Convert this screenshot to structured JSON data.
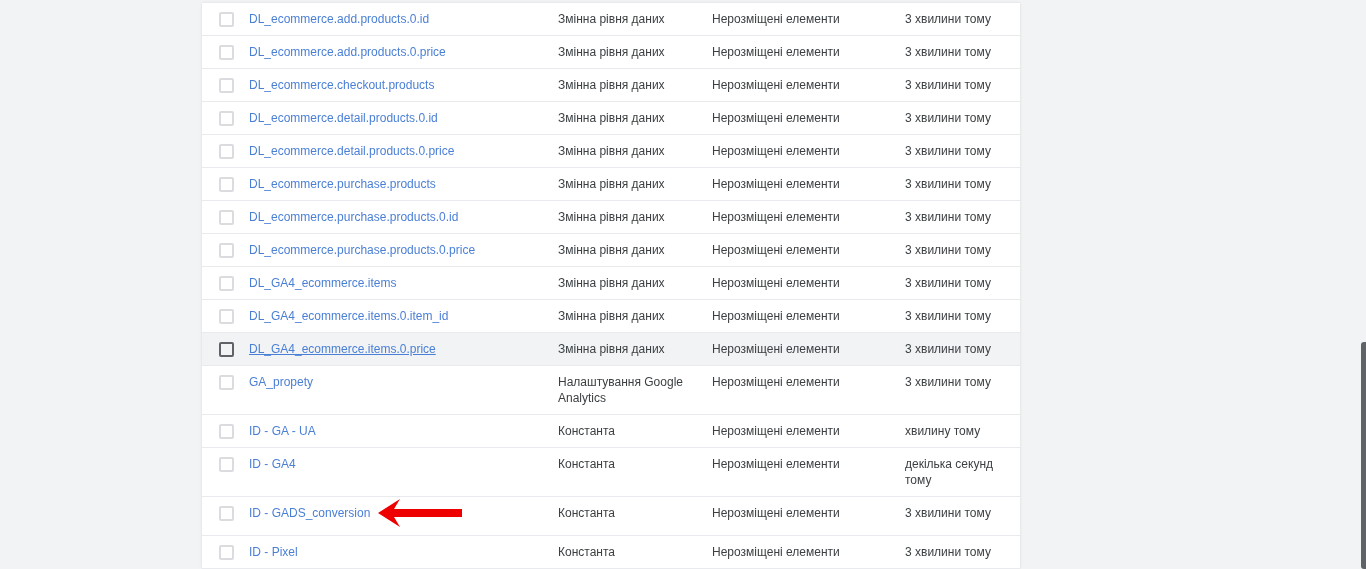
{
  "table": {
    "rows": [
      {
        "name": "DL_ecommerce.add.products.0.id",
        "type": "Змінна рівня даних",
        "folder": "Нерозміщені елементи",
        "edited": "3 хвилини тому",
        "checked": false,
        "hovered": false,
        "annotated": false
      },
      {
        "name": "DL_ecommerce.add.products.0.price",
        "type": "Змінна рівня даних",
        "folder": "Нерозміщені елементи",
        "edited": "3 хвилини тому",
        "checked": false,
        "hovered": false,
        "annotated": false
      },
      {
        "name": "DL_ecommerce.checkout.products",
        "type": "Змінна рівня даних",
        "folder": "Нерозміщені елементи",
        "edited": "3 хвилини тому",
        "checked": false,
        "hovered": false,
        "annotated": false
      },
      {
        "name": "DL_ecommerce.detail.products.0.id",
        "type": "Змінна рівня даних",
        "folder": "Нерозміщені елементи",
        "edited": "3 хвилини тому",
        "checked": false,
        "hovered": false,
        "annotated": false
      },
      {
        "name": "DL_ecommerce.detail.products.0.price",
        "type": "Змінна рівня даних",
        "folder": "Нерозміщені елементи",
        "edited": "3 хвилини тому",
        "checked": false,
        "hovered": false,
        "annotated": false
      },
      {
        "name": "DL_ecommerce.purchase.products",
        "type": "Змінна рівня даних",
        "folder": "Нерозміщені елементи",
        "edited": "3 хвилини тому",
        "checked": false,
        "hovered": false,
        "annotated": false
      },
      {
        "name": "DL_ecommerce.purchase.products.0.id",
        "type": "Змінна рівня даних",
        "folder": "Нерозміщені елементи",
        "edited": "3 хвилини тому",
        "checked": false,
        "hovered": false,
        "annotated": false
      },
      {
        "name": "DL_ecommerce.purchase.products.0.price",
        "type": "Змінна рівня даних",
        "folder": "Нерозміщені елементи",
        "edited": "3 хвилини тому",
        "checked": false,
        "hovered": false,
        "annotated": false
      },
      {
        "name": "DL_GA4_ecommerce.items",
        "type": "Змінна рівня даних",
        "folder": "Нерозміщені елементи",
        "edited": "3 хвилини тому",
        "checked": false,
        "hovered": false,
        "annotated": false
      },
      {
        "name": "DL_GA4_ecommerce.items.0.item_id",
        "type": "Змінна рівня даних",
        "folder": "Нерозміщені елементи",
        "edited": "3 хвилини тому",
        "checked": false,
        "hovered": false,
        "annotated": false
      },
      {
        "name": "DL_GA4_ecommerce.items.0.price",
        "type": "Змінна рівня даних",
        "folder": "Нерозміщені елементи",
        "edited": "3 хвилини тому",
        "checked": false,
        "hovered": true,
        "annotated": false
      },
      {
        "name": "GA_propety",
        "type": "Налаштування Google Analytics",
        "folder": "Нерозміщені елементи",
        "edited": "3 хвилини тому",
        "checked": false,
        "hovered": false,
        "annotated": false
      },
      {
        "name": "ID - GA - UA",
        "type": "Константа",
        "folder": "Нерозміщені елементи",
        "edited": "хвилину тому",
        "checked": false,
        "hovered": false,
        "annotated": false
      },
      {
        "name": "ID - GA4",
        "type": "Константа",
        "folder": "Нерозміщені елементи",
        "edited": "декілька секунд тому",
        "checked": false,
        "hovered": false,
        "annotated": false
      },
      {
        "name": "ID - GADS_conversion",
        "type": "Константа",
        "folder": "Нерозміщені елементи",
        "edited": "3 хвилини тому",
        "checked": false,
        "hovered": false,
        "annotated": true
      },
      {
        "name": "ID - Pixel",
        "type": "Константа",
        "folder": "Нерозміщені елементи",
        "edited": "3 хвилини тому",
        "checked": false,
        "hovered": false,
        "annotated": false
      }
    ]
  }
}
